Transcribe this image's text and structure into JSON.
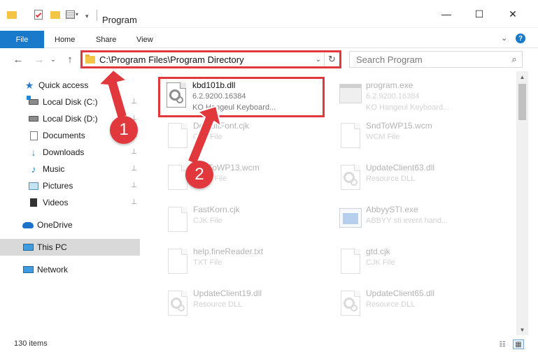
{
  "window": {
    "title": "Program",
    "minimize_glyph": "—",
    "maximize_glyph": "☐",
    "close_glyph": "✕"
  },
  "ribbon": {
    "tabs": [
      "File",
      "Home",
      "Share",
      "View"
    ],
    "expand_glyph": "⌄",
    "help_glyph": "?"
  },
  "nav": {
    "back_glyph": "←",
    "forward_glyph": "→",
    "recent_glyph": "⌄",
    "up_glyph": "↑",
    "address": "C:\\Program Files\\Program Directory",
    "address_chevron": "⌄",
    "refresh_glyph": "↻",
    "search_placeholder": "Search Program",
    "search_glyph": "⌕"
  },
  "sidebar": {
    "items": [
      {
        "label": "Quick access",
        "icon": "star-icon",
        "pinned": false
      },
      {
        "label": "Local Disk (C:)",
        "icon": "drive-icon",
        "pinned": true
      },
      {
        "label": "Local Disk (D:)",
        "icon": "drive-icon",
        "pinned": true
      },
      {
        "label": "Documents",
        "icon": "documents-icon",
        "pinned": true
      },
      {
        "label": "Downloads",
        "icon": "downloads-icon",
        "pinned": true
      },
      {
        "label": "Music",
        "icon": "music-icon",
        "pinned": true
      },
      {
        "label": "Pictures",
        "icon": "pictures-icon",
        "pinned": true
      },
      {
        "label": "Videos",
        "icon": "videos-icon",
        "pinned": true
      },
      {
        "label": "OneDrive",
        "icon": "onedrive-icon",
        "pinned": false
      },
      {
        "label": "This PC",
        "icon": "pc-icon",
        "pinned": false,
        "selected": true
      },
      {
        "label": "Network",
        "icon": "network-icon",
        "pinned": false
      }
    ],
    "pin_glyph": "📌"
  },
  "files": [
    {
      "name": "kbd101b.dll",
      "line2": "6.2.9200.16384",
      "line3": "KO Hangeul Keyboard...",
      "icon": "dll-gear-icon"
    },
    {
      "name": "program.exe",
      "line2": "6.2.9200.16384",
      "line3": "KO Hangeul Keyboard...",
      "icon": "exe-icon"
    },
    {
      "name": "DefaultFont.cjk",
      "line2": "CJK File",
      "line3": "",
      "icon": "document-icon"
    },
    {
      "name": "SndToWP15.wcm",
      "line2": "WCM File",
      "line3": "",
      "icon": "document-icon"
    },
    {
      "name": "SndToWP13.wcm",
      "line2": "WCM File",
      "line3": "",
      "icon": "document-icon"
    },
    {
      "name": "UpdateClient63.dll",
      "line2": "Resource DLL",
      "line3": "",
      "icon": "dll-gear-icon"
    },
    {
      "name": "FastKorn.cjk",
      "line2": "CJK File",
      "line3": "",
      "icon": "document-icon"
    },
    {
      "name": "AbbyySTI.exe",
      "line2": "ABBYY sti event hand...",
      "line3": "",
      "icon": "app-icon"
    },
    {
      "name": "help.fineReader.txt",
      "line2": "TXT File",
      "line3": "",
      "icon": "document-icon"
    },
    {
      "name": "gtd.cjk",
      "line2": "CJK File",
      "line3": "",
      "icon": "document-icon"
    },
    {
      "name": "UpdateClient19.dll",
      "line2": "Resource DLL",
      "line3": "",
      "icon": "dll-gear-icon"
    },
    {
      "name": "UpdateClient65.dll",
      "line2": "Resource DLL",
      "line3": "",
      "icon": "dll-gear-icon"
    }
  ],
  "status": {
    "item_count": "130 items"
  },
  "annotations": {
    "step1": "1",
    "step2": "2"
  },
  "colors": {
    "accent": "#1979ca",
    "annotation_red": "#e0383c",
    "selected_bg": "#d9d9d9"
  }
}
